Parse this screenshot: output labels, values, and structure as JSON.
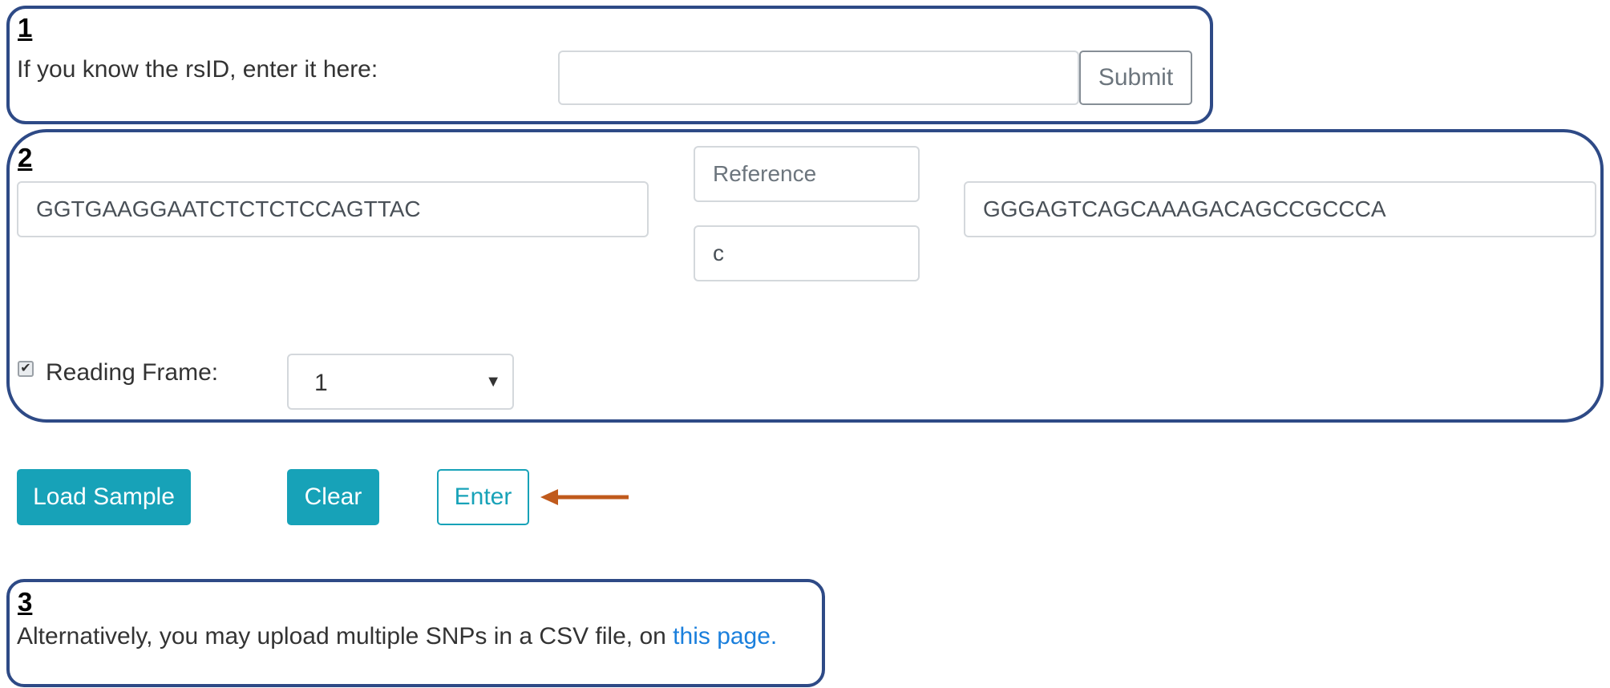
{
  "section1": {
    "number": "1",
    "label": "If you know the rsID, enter it here:",
    "rsid_value": "",
    "submit_label": "Submit"
  },
  "section2": {
    "number": "2",
    "left_sequence": "GGTGAAGGAATCTCTCTCCAGTTAC",
    "reference_placeholder": "Reference",
    "alternate_value": "c",
    "right_sequence": "GGGAGTCAGCAAAGACAGCCGCCCA",
    "reading_frame_checked": true,
    "reading_frame_label": "Reading Frame:",
    "reading_frame_selected": "1"
  },
  "actions": {
    "load_sample_label": "Load Sample",
    "clear_label": "Clear",
    "enter_label": "Enter",
    "arrow_color": "#c05a1c"
  },
  "section3": {
    "number": "3",
    "text": "Alternatively, you may upload multiple SNPs in a CSV file, on ",
    "link_text": "this page."
  },
  "colors": {
    "box_border": "#2e4a86",
    "teal": "#17a2b8",
    "link": "#1a7fdc"
  }
}
